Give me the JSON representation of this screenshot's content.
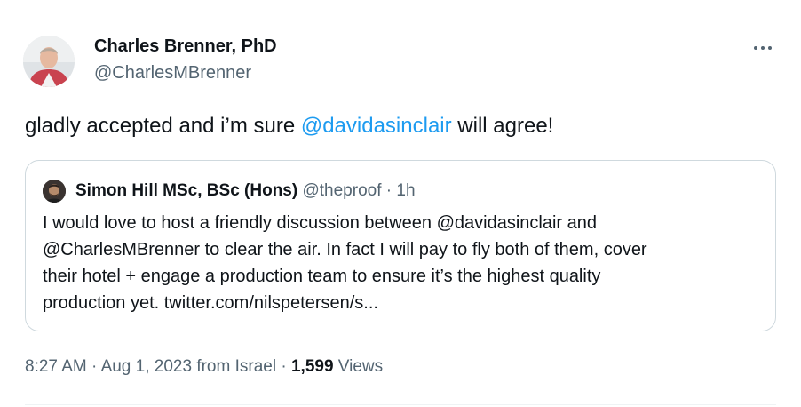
{
  "author": {
    "name": "Charles Brenner, PhD",
    "handle": "@CharlesMBrenner",
    "avatar_icon": "profile-photo"
  },
  "more_icon": "ellipsis-icon",
  "tweet": {
    "text_before": "gladly accepted and i’m sure ",
    "mention": "@davidasinclair",
    "text_after": " will agree!"
  },
  "quoted": {
    "name": "Simon Hill MSc, BSc (Hons)",
    "handle": "@theproof",
    "separator": " · ",
    "time": "1h",
    "lines": [
      "I would love to host a friendly discussion between @davidasinclair and",
      "@CharlesMBrenner to clear the air. In fact I will pay to fly both of them, cover",
      "their hotel + engage a production team to ensure it’s the highest quality",
      "production yet. twitter.com/nilspetersen/s..."
    ]
  },
  "footer": {
    "time": "8:27 AM",
    "sep1": " · ",
    "date": "Aug 1, 2023",
    "location": " from Israel",
    "sep2": " · ",
    "views_count": "1,599",
    "views_label": " Views"
  },
  "colors": {
    "link": "#1d9bf0",
    "secondary": "#536471",
    "primary": "#0f1419",
    "border": "#cfd9de"
  }
}
